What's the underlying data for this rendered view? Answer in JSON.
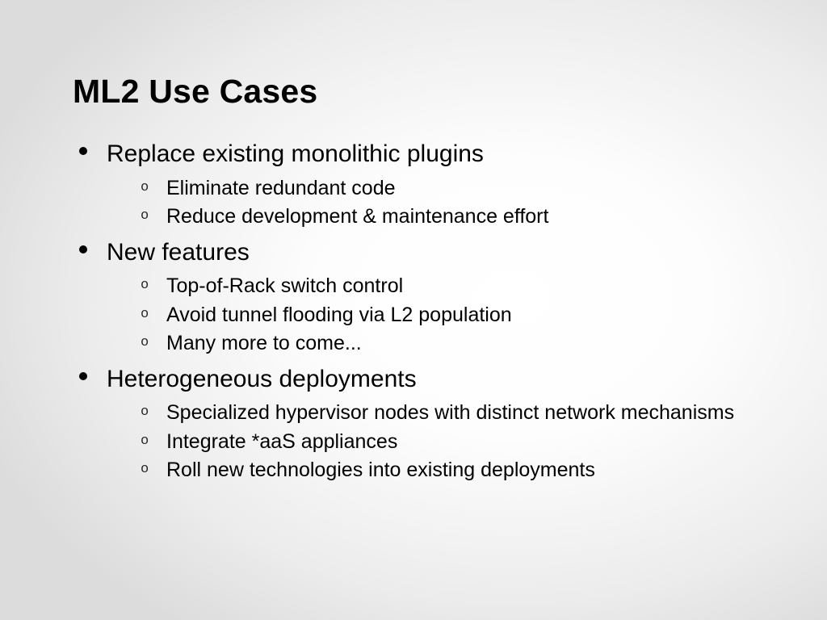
{
  "slide": {
    "title": "ML2 Use Cases",
    "bullets": [
      {
        "text": "Replace existing monolithic plugins",
        "sub": [
          "Eliminate redundant code",
          "Reduce development & maintenance effort"
        ]
      },
      {
        "text": "New features",
        "sub": [
          "Top-of-Rack switch control",
          "Avoid tunnel flooding via L2 population",
          "Many more to come..."
        ]
      },
      {
        "text": "Heterogeneous deployments",
        "sub": [
          "Specialized hypervisor nodes with distinct network mechanisms",
          "Integrate *aaS appliances",
          "Roll new technologies into existing deployments"
        ]
      }
    ]
  }
}
